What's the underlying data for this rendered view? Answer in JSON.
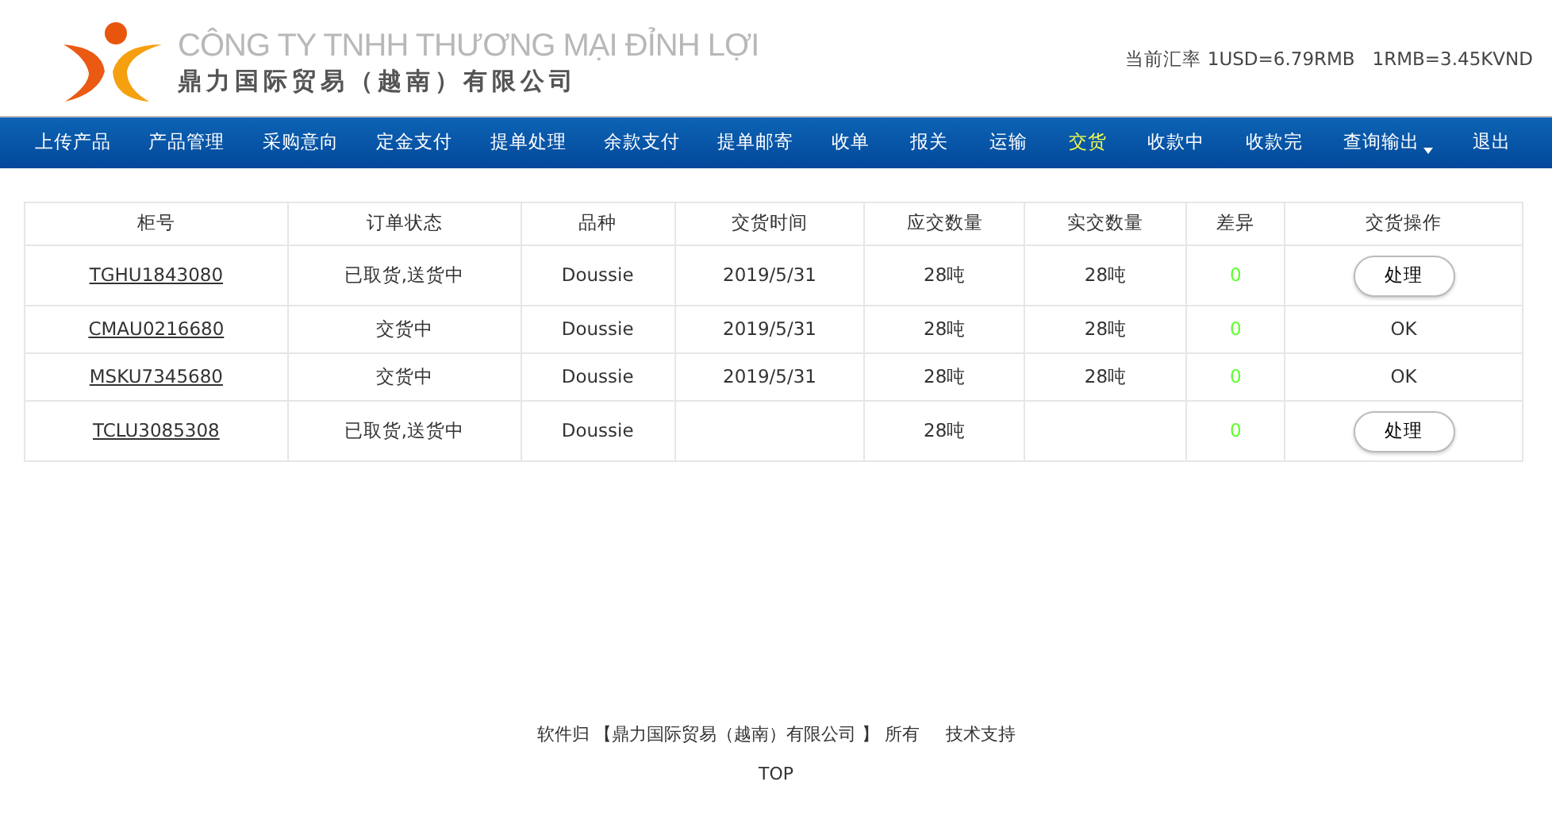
{
  "header": {
    "company_name_vi": "CÔNG TY TNHH THƯƠNG MẠI ĐỈNH LỢI",
    "company_name_zh": "鼎力国际贸易（越南）有限公司",
    "exchange_rate": "当前汇率 1USD=6.79RMB   1RMB=3.45KVND"
  },
  "nav": [
    {
      "label": "上传产品",
      "selected": false,
      "kind": "link"
    },
    {
      "label": "产品管理",
      "selected": false,
      "kind": "link"
    },
    {
      "label": "采购意向",
      "selected": false,
      "kind": "link"
    },
    {
      "label": "定金支付",
      "selected": false,
      "kind": "link"
    },
    {
      "label": "提单处理",
      "selected": false,
      "kind": "link"
    },
    {
      "label": "余款支付",
      "selected": false,
      "kind": "link"
    },
    {
      "label": "提单邮寄",
      "selected": false,
      "kind": "link"
    },
    {
      "label": "收单",
      "selected": false,
      "kind": "link"
    },
    {
      "label": "报关",
      "selected": false,
      "kind": "link"
    },
    {
      "label": "运输",
      "selected": false,
      "kind": "link"
    },
    {
      "label": "交货",
      "selected": true,
      "kind": "link"
    },
    {
      "label": "收款中",
      "selected": false,
      "kind": "link"
    },
    {
      "label": "收款完",
      "selected": false,
      "kind": "link"
    },
    {
      "label": "查询输出",
      "selected": false,
      "kind": "dropdown"
    },
    {
      "label": "退出",
      "selected": false,
      "kind": "link"
    }
  ],
  "table": {
    "columns": [
      "柜号",
      "订单状态",
      "品种",
      "交货时间",
      "应交数量",
      "实交数量",
      "差异",
      "交货操作"
    ],
    "rows": [
      {
        "container": "TGHU1843080",
        "status": "已取货,送货中",
        "variety": "Doussie",
        "delivery_time": "2019/5/31",
        "due_qty": "28吨",
        "actual_qty": "28吨",
        "difference": "0",
        "action": {
          "kind": "button",
          "label": "处理"
        }
      },
      {
        "container": "CMAU0216680",
        "status": "交货中",
        "variety": "Doussie",
        "delivery_time": "2019/5/31",
        "due_qty": "28吨",
        "actual_qty": "28吨",
        "difference": "0",
        "action": {
          "kind": "text",
          "label": "OK"
        }
      },
      {
        "container": "MSKU7345680",
        "status": "交货中",
        "variety": "Doussie",
        "delivery_time": "2019/5/31",
        "due_qty": "28吨",
        "actual_qty": "28吨",
        "difference": "0",
        "action": {
          "kind": "text",
          "label": "OK"
        }
      },
      {
        "container": "TCLU3085308",
        "status": "已取货,送货中",
        "variety": "Doussie",
        "due_qty": "28吨",
        "difference": "0",
        "action": {
          "kind": "button",
          "label": "处理"
        }
      }
    ]
  },
  "footer": {
    "copyright": "软件归 【鼎力国际贸易（越南）有限公司 】 所有",
    "support_link": "技术支持",
    "top_link": "TOP"
  }
}
